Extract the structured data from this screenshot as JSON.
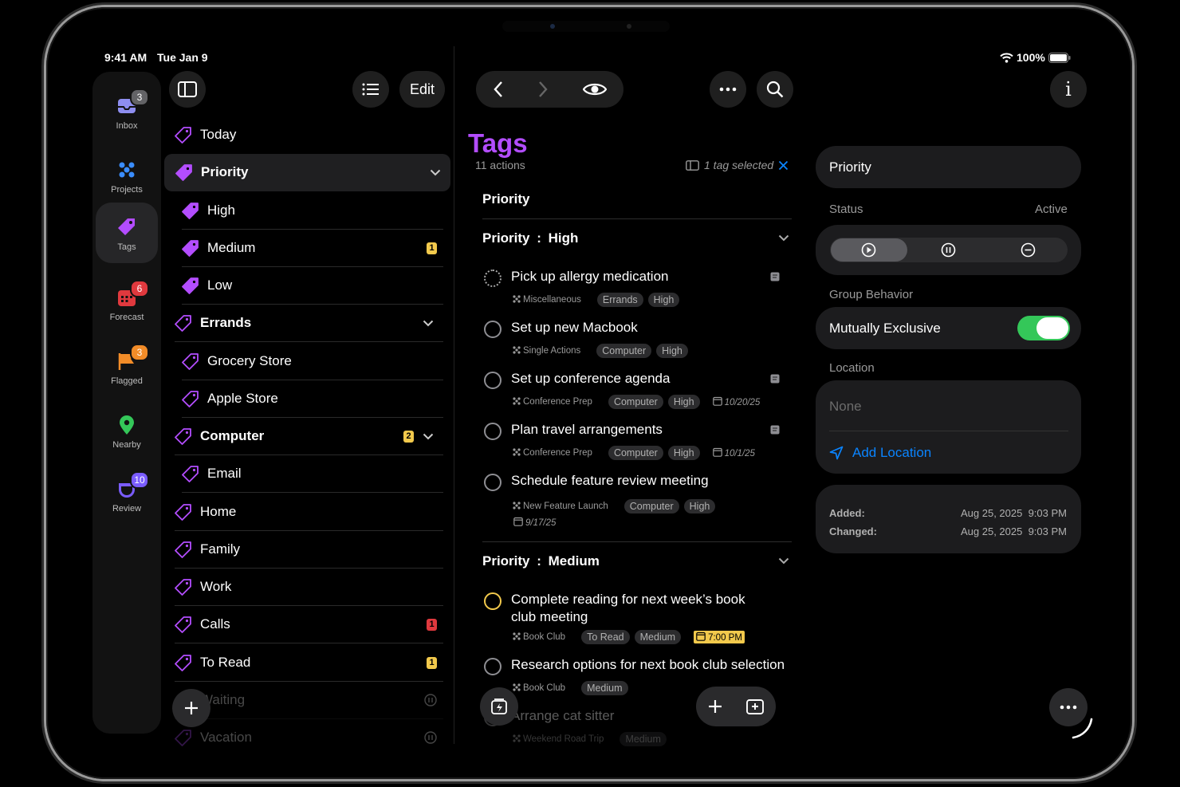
{
  "status_bar": {
    "time": "9:41 AM",
    "date": "Tue Jan 9",
    "battery": "100%"
  },
  "rail": [
    {
      "key": "inbox",
      "label": "Inbox",
      "badge": "3",
      "badge_color": "#636366",
      "icon": "inbox-icon",
      "color": "#8e8ef0"
    },
    {
      "key": "projects",
      "label": "Projects",
      "badge": "",
      "icon": "projects-icon",
      "color": "#3a8dff"
    },
    {
      "key": "tags",
      "label": "Tags",
      "badge": "",
      "icon": "tag-icon",
      "color": "#b34dff"
    },
    {
      "key": "forecast",
      "label": "Forecast",
      "badge": "6",
      "badge_color": "#e0393e",
      "icon": "calendar-icon",
      "color": "#e0393e"
    },
    {
      "key": "flagged",
      "label": "Flagged",
      "badge": "3",
      "badge_color": "#f28c28",
      "icon": "flag-icon",
      "color": "#f28c28"
    },
    {
      "key": "nearby",
      "label": "Nearby",
      "badge": "",
      "icon": "location-pin-icon",
      "color": "#34c759"
    },
    {
      "key": "review",
      "label": "Review",
      "badge": "10",
      "badge_color": "#7a5cff",
      "icon": "review-icon",
      "color": "#7a5cff"
    }
  ],
  "sidebar": {
    "edit_label": "Edit",
    "items": [
      {
        "label": "Today",
        "level": 0,
        "count": "",
        "count_color": "",
        "chevron": false,
        "selected": false,
        "filled": false
      },
      {
        "label": "Priority",
        "level": 0,
        "count": "",
        "chevron": true,
        "selected": true,
        "filled": true
      },
      {
        "label": "High",
        "level": 1,
        "count": "",
        "chevron": false,
        "selected": false,
        "filled": true
      },
      {
        "label": "Medium",
        "level": 1,
        "count": "1",
        "count_color": "#f2c94c",
        "chevron": false,
        "selected": false,
        "filled": true
      },
      {
        "label": "Low",
        "level": 1,
        "count": "",
        "chevron": false,
        "selected": false,
        "filled": true
      },
      {
        "label": "Errands",
        "level": 0,
        "count": "",
        "chevron": true,
        "selected": false,
        "filled": false
      },
      {
        "label": "Grocery Store",
        "level": 1,
        "count": "",
        "chevron": false,
        "selected": false,
        "filled": false
      },
      {
        "label": "Apple Store",
        "level": 1,
        "count": "",
        "chevron": false,
        "selected": false,
        "filled": false
      },
      {
        "label": "Computer",
        "level": 0,
        "count": "2",
        "count_color": "#f2c94c",
        "chevron": true,
        "selected": false,
        "filled": false
      },
      {
        "label": "Email",
        "level": 1,
        "count": "",
        "chevron": false,
        "selected": false,
        "filled": false
      },
      {
        "label": "Home",
        "level": 0,
        "count": "",
        "chevron": false,
        "selected": false,
        "filled": false
      },
      {
        "label": "Family",
        "level": 0,
        "count": "",
        "chevron": false,
        "selected": false,
        "filled": false
      },
      {
        "label": "Work",
        "level": 0,
        "count": "",
        "chevron": false,
        "selected": false,
        "filled": false
      },
      {
        "label": "Calls",
        "level": 0,
        "count": "1",
        "count_color": "#e0393e",
        "chevron": false,
        "selected": false,
        "filled": false
      },
      {
        "label": "To Read",
        "level": 0,
        "count": "1",
        "count_color": "#f2c94c",
        "chevron": false,
        "selected": false,
        "filled": false
      },
      {
        "label": "Waiting",
        "level": 0,
        "count": "",
        "chevron": false,
        "selected": false,
        "filled": false,
        "faded": true,
        "paused": true
      },
      {
        "label": "Vacation",
        "level": 0,
        "count": "",
        "chevron": false,
        "selected": false,
        "filled": false,
        "faded": true,
        "paused": true
      }
    ]
  },
  "main": {
    "title": "Tags",
    "subtitle": "11 actions",
    "selection_text": "1 tag selected",
    "group_title": "Priority",
    "sections": [
      {
        "title": "Priority : High"
      },
      {
        "title": "Priority : Medium"
      }
    ],
    "tasks": [
      {
        "title": "Pick up allergy medication",
        "project": "Miscellaneous",
        "tags": [
          "Errands",
          "High"
        ],
        "date": "",
        "note": true,
        "status": "dotted"
      },
      {
        "title": "Set up new Macbook",
        "project": "Single Actions",
        "tags": [
          "Computer",
          "High"
        ],
        "date": "",
        "note": false,
        "status": "open"
      },
      {
        "title": "Set up conference agenda",
        "project": "Conference Prep",
        "tags": [
          "Computer",
          "High"
        ],
        "date": "10/20/25",
        "note": true,
        "status": "open"
      },
      {
        "title": "Plan travel arrangements",
        "project": "Conference Prep",
        "tags": [
          "Computer",
          "High"
        ],
        "date": "10/1/25",
        "note": true,
        "status": "open"
      },
      {
        "title": "Schedule feature review meeting",
        "project": "New Feature Launch",
        "tags": [
          "Computer",
          "High"
        ],
        "date": "9/17/25",
        "note": false,
        "status": "open"
      },
      {
        "title": "Complete reading for next week’s book",
        "title2": "club meeting",
        "project": "Book Club",
        "tags": [
          "To Read",
          "Medium"
        ],
        "date": "7:00 PM",
        "note": false,
        "status": "due"
      },
      {
        "title": "Research options for next book club selection",
        "project": "Book Club",
        "tags": [
          "Medium"
        ],
        "date": "",
        "note": false,
        "status": "open"
      },
      {
        "title": "Arrange cat sitter",
        "project": "Weekend Road Trip",
        "tags": [
          "Medium"
        ],
        "date": "",
        "note": false,
        "status": "open",
        "faded": true
      }
    ]
  },
  "inspector": {
    "name_value": "Priority",
    "status_label": "Status",
    "status_value": "Active",
    "group_label": "Group Behavior",
    "group_value": "Mutually Exclusive",
    "toggle_on": true,
    "location_label": "Location",
    "location_placeholder": "None",
    "add_location": "Add Location",
    "added_label": "Added:",
    "added_value": "Aug 25, 2025  9:03 PM",
    "changed_label": "Changed:",
    "changed_value": "Aug 25, 2025  9:03 PM"
  },
  "colors": {
    "accent": "#b34dff",
    "blue": "#0a84ff",
    "green": "#34c759",
    "card": "#1c1c1e"
  }
}
